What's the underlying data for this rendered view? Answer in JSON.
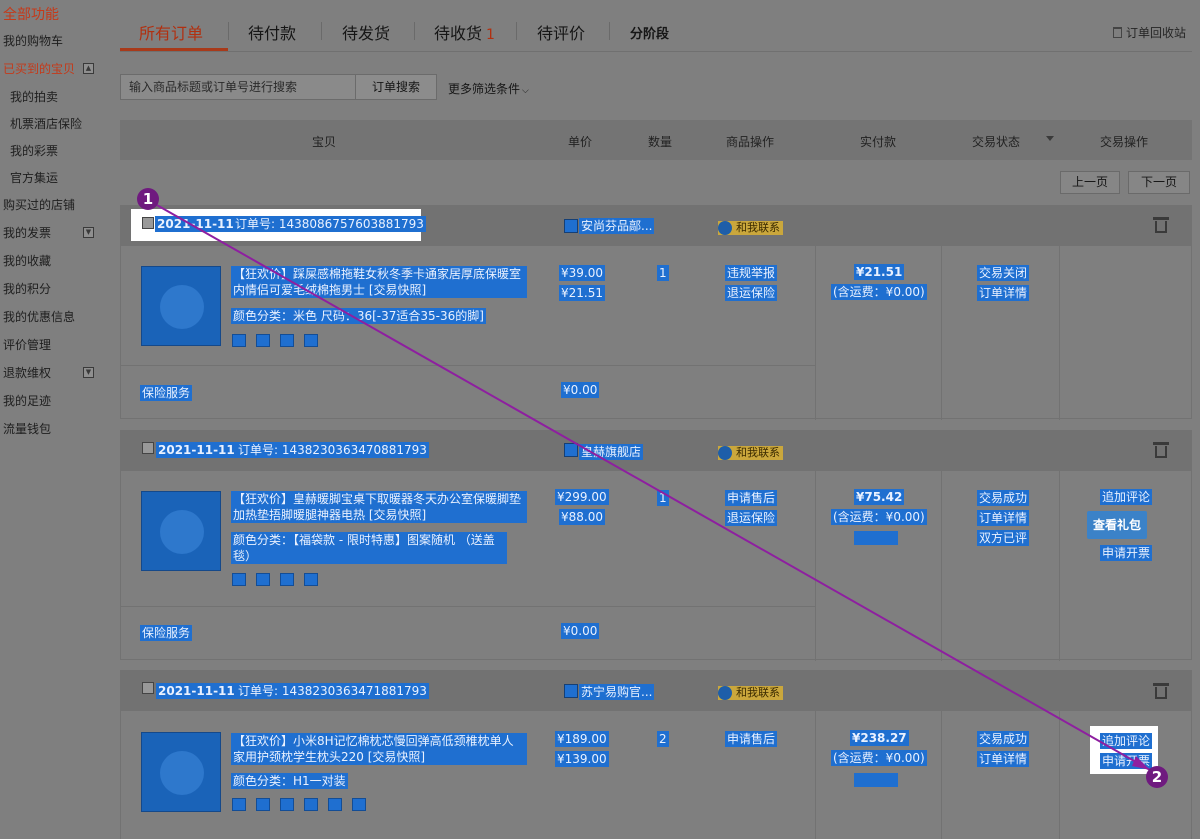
{
  "sidebar": {
    "title": "全部功能",
    "items": [
      {
        "label": "我的购物车",
        "sub": false,
        "active": false,
        "toggle": ""
      },
      {
        "label": "已买到的宝贝",
        "sub": false,
        "active": true,
        "toggle": "▲"
      },
      {
        "label": "我的拍卖",
        "sub": true,
        "active": false,
        "toggle": ""
      },
      {
        "label": "机票酒店保险",
        "sub": true,
        "active": false,
        "toggle": ""
      },
      {
        "label": "我的彩票",
        "sub": true,
        "active": false,
        "toggle": ""
      },
      {
        "label": "官方集运",
        "sub": true,
        "active": false,
        "toggle": ""
      },
      {
        "label": "购买过的店铺",
        "sub": false,
        "active": false,
        "toggle": ""
      },
      {
        "label": "我的发票",
        "sub": false,
        "active": false,
        "toggle": "▼"
      },
      {
        "label": "我的收藏",
        "sub": false,
        "active": false,
        "toggle": ""
      },
      {
        "label": "我的积分",
        "sub": false,
        "active": false,
        "toggle": ""
      },
      {
        "label": "我的优惠信息",
        "sub": false,
        "active": false,
        "toggle": ""
      },
      {
        "label": "评价管理",
        "sub": false,
        "active": false,
        "toggle": ""
      },
      {
        "label": "退款维权",
        "sub": false,
        "active": false,
        "toggle": "▼"
      },
      {
        "label": "我的足迹",
        "sub": false,
        "active": false,
        "toggle": ""
      },
      {
        "label": "流量钱包",
        "sub": false,
        "active": false,
        "toggle": ""
      }
    ]
  },
  "tabs": {
    "all": "所有订单",
    "pay": "待付款",
    "ship": "待发货",
    "receive": "待收货",
    "receive_count": "1",
    "review": "待评价",
    "stage": "分阶段",
    "recycle": "订单回收站"
  },
  "search": {
    "placeholder": "输入商品标题或订单号进行搜索",
    "button": "订单搜索",
    "more_filters": "更多筛选条件"
  },
  "table_header": {
    "item": "宝贝",
    "price": "单价",
    "qty": "数量",
    "item_ops": "商品操作",
    "paid": "实付款",
    "status": "交易状态",
    "trade_ops": "交易操作"
  },
  "pager": {
    "prev": "上一页",
    "next": "下一页"
  },
  "contact_label": "和我联系",
  "order_no_prefix": "订单号: ",
  "orders": [
    {
      "date": "2021-11-11",
      "order_no": "1438086757603881793",
      "shop": "安尚芬品鄗...",
      "title": "【狂欢价】踩屎感棉拖鞋女秋冬季卡通家居厚底保暖室内情侣可爱毛绒棉拖男士 [交易快照]",
      "sku": "颜色分类：米色  尺码：36[-37适合35-36的脚]",
      "orig_price": "¥39.00",
      "price": "¥21.51",
      "qty": "1",
      "item_ops": [
        "违规举报",
        "退运保险"
      ],
      "paid": "¥21.51",
      "shipping": "(含运费：¥0.00)",
      "status": [
        "交易关闭",
        "订单详情"
      ],
      "trade_ops": [],
      "service": "保险服务",
      "service_price": "¥0.00"
    },
    {
      "date": "2021-11-11",
      "order_no": "1438230363470881793",
      "shop": "皇赫旗舰店",
      "title": "【狂欢价】皇赫暖脚宝桌下取暖器冬天办公室保暖脚垫加热垫捂脚暖腿神器电热 [交易快照]",
      "sku": "颜色分类：【福袋款 - 限时特惠】图案随机 （送盖毯）",
      "orig_price": "¥299.00",
      "price": "¥88.00",
      "qty": "1",
      "item_ops": [
        "申请售后",
        "退运保险"
      ],
      "paid": "¥75.42",
      "shipping": "(含运费：¥0.00)",
      "status": [
        "交易成功",
        "订单详情",
        "双方已评"
      ],
      "trade_ops": [
        "追加评论",
        "查看礼包",
        "申请开票"
      ],
      "service": "保险服务",
      "service_price": "¥0.00"
    },
    {
      "date": "2021-11-11",
      "order_no": "1438230363471881793",
      "shop": "苏宁易购官...",
      "title": "【狂欢价】小米8H记忆棉枕芯慢回弹高低颈椎枕单人家用护颈枕学生枕头220 [交易快照]",
      "sku": "颜色分类：H1一对装",
      "orig_price": "¥189.00",
      "price": "¥139.00",
      "qty": "2",
      "item_ops": [
        "申请售后"
      ],
      "paid": "¥238.27",
      "shipping": "(含运费：¥0.00)",
      "status": [
        "交易成功",
        "订单详情"
      ],
      "trade_ops": [
        "追加评论",
        "申请开票"
      ]
    }
  ],
  "annotations": {
    "start_label": "1",
    "end_label": "2",
    "line_color": "#8e1fa0"
  }
}
